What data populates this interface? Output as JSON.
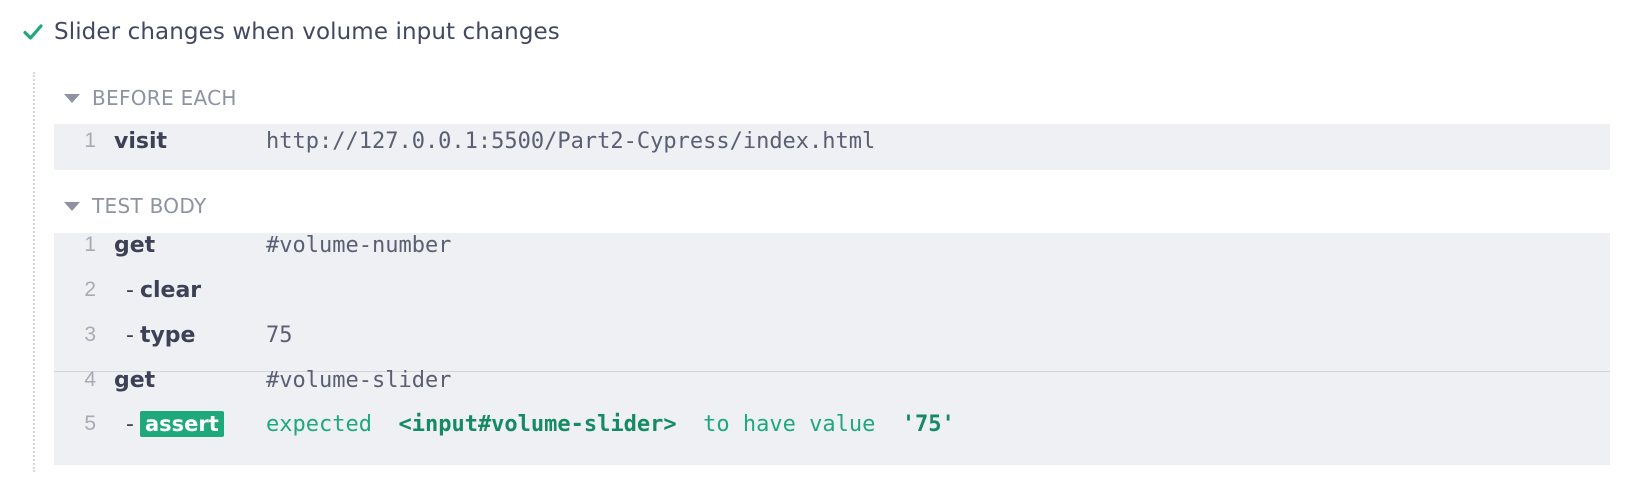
{
  "test": {
    "title": "Slider changes when volume input changes",
    "status_icon": "check-icon",
    "status_color": "#1fa97a"
  },
  "before_each": {
    "label": "BEFORE EACH",
    "commands": [
      {
        "number": "1",
        "name": "visit",
        "message": "http://127.0.0.1:5500/Part2-Cypress/index.html"
      }
    ]
  },
  "test_body": {
    "label": "TEST BODY",
    "commands": [
      {
        "number": "1",
        "name": "get",
        "message": "#volume-number"
      },
      {
        "number": "2",
        "dash": "-",
        "name": "clear",
        "message": ""
      },
      {
        "number": "3",
        "dash": "-",
        "name": "type",
        "message": "75"
      },
      {
        "number": "4",
        "name": "get",
        "message": "#volume-slider"
      },
      {
        "number": "5",
        "dash": "-",
        "name": "assert",
        "message_prefix": "expected",
        "message_element": "<input#volume-slider>",
        "message_middle": "to have value",
        "message_value": "'75'"
      }
    ]
  }
}
